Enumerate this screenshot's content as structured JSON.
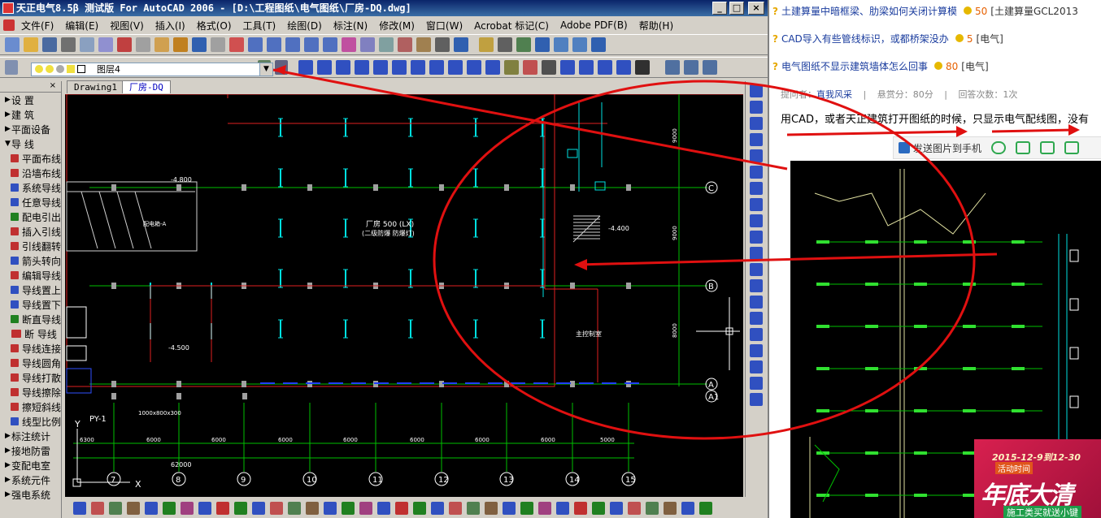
{
  "window": {
    "title": "天正电气8.5β 测试版 For AutoCAD 2006 - [D:\\工程图纸\\电气图纸\\厂房-DQ.dwg]",
    "min": "_",
    "max": "□",
    "close": "×"
  },
  "menu": [
    "文件(F)",
    "编辑(E)",
    "视图(V)",
    "插入(I)",
    "格式(O)",
    "工具(T)",
    "绘图(D)",
    "标注(N)",
    "修改(M)",
    "窗口(W)",
    "Acrobat 标记(C)",
    "Adobe PDF(B)",
    "帮助(H)"
  ],
  "layer": {
    "name": "图层4"
  },
  "panel": {
    "close": "×",
    "items": [
      {
        "arrow": "▶",
        "label": "设  置",
        "color": ""
      },
      {
        "arrow": "▶",
        "label": "建  筑",
        "color": ""
      },
      {
        "arrow": "▶",
        "label": "平面设备",
        "color": ""
      },
      {
        "arrow": "▼",
        "label": "导  线",
        "color": ""
      },
      {
        "arrow": "",
        "label": "平面布线",
        "color": "#c03030"
      },
      {
        "arrow": "",
        "label": "沿墙布线",
        "color": "#c03030"
      },
      {
        "arrow": "",
        "label": "系统导线",
        "color": "#3050c0"
      },
      {
        "arrow": "",
        "label": "任意导线",
        "color": "#3050c0"
      },
      {
        "arrow": "",
        "label": "配电引出",
        "color": "#208020"
      },
      {
        "arrow": "",
        "label": "插入引线",
        "color": "#c03030"
      },
      {
        "arrow": "",
        "label": "引线翻转",
        "color": "#c03030"
      },
      {
        "arrow": "",
        "label": "箭头转向",
        "color": "#3050c0"
      },
      {
        "arrow": "",
        "label": "编辑导线",
        "color": "#c03030"
      },
      {
        "arrow": "",
        "label": "导线置上",
        "color": "#3050c0"
      },
      {
        "arrow": "",
        "label": "导线置下",
        "color": "#3050c0"
      },
      {
        "arrow": "",
        "label": "断直导线",
        "color": "#208020"
      },
      {
        "arrow": "",
        "label": "断  导线",
        "color": "#c03030"
      },
      {
        "arrow": "",
        "label": "导线连接",
        "color": "#c03030"
      },
      {
        "arrow": "",
        "label": "导线圆角",
        "color": "#c03030"
      },
      {
        "arrow": "",
        "label": "导线打散",
        "color": "#c03030"
      },
      {
        "arrow": "",
        "label": "导线擦除",
        "color": "#c03030"
      },
      {
        "arrow": "",
        "label": "擦短斜线",
        "color": "#c03030"
      },
      {
        "arrow": "",
        "label": "线型比例",
        "color": "#3050c0"
      },
      {
        "arrow": "▶",
        "label": "标注统计",
        "color": ""
      },
      {
        "arrow": "▶",
        "label": "接地防雷",
        "color": ""
      },
      {
        "arrow": "▶",
        "label": "变配电室",
        "color": ""
      },
      {
        "arrow": "▶",
        "label": "系统元件",
        "color": ""
      },
      {
        "arrow": "▶",
        "label": "强电系统",
        "color": ""
      }
    ]
  },
  "tabs": [
    {
      "label": "Drawing1"
    },
    {
      "label": "厂房-DQ"
    }
  ],
  "drawing": {
    "room_label": "厂房 500 (LX)",
    "room_sub": "(二级防爆 防爆灯)",
    "room2": "主控制室",
    "axis_rows": [
      "C",
      "B",
      "A",
      "A1"
    ],
    "axis_cols": [
      "7",
      "8",
      "9",
      "10",
      "11",
      "12",
      "13",
      "14",
      "15"
    ],
    "dims": [
      "6300",
      "6000",
      "6000",
      "6000",
      "6000",
      "6000",
      "6000",
      "6000",
      "5000"
    ],
    "total_dim": "62000",
    "row_dims": [
      "9000",
      "9000",
      "8000"
    ],
    "elev1": "-4.800",
    "elev2": "-4.400",
    "elev3": "-4.500",
    "elev4": "-4.800",
    "box_label": "配电箱-A",
    "ps_label": "PY-1",
    "y_axis": "Y",
    "x_axis": "X",
    "misc": "1000x800x300"
  },
  "web": {
    "questions": [
      {
        "title": "土建算量中暗框梁、肋梁如何关闭计算模",
        "points": "50",
        "category": "[土建算量GCL2013"
      },
      {
        "title": "CAD导入有些管线标识，或都桥架没办",
        "points": "5",
        "category": "[电气]"
      },
      {
        "title": "电气图纸不显示建筑墙体怎么回事",
        "points": "80",
        "category": "[电气]"
      }
    ],
    "meta": {
      "asker_label": "提问者：",
      "asker": "直我风采",
      "reward": "悬赏分：80分",
      "answers": "回答次数：1次",
      "sep": "|"
    },
    "body": "用CAD，或者天正建筑打开图纸的时候，只显示电气配线图，没有",
    "send": "发送图片到手机"
  },
  "ad": {
    "date": "2015-12-9到12-30",
    "tag": "活动时间",
    "headline": "年底大清",
    "sub": "施工类买就送小键"
  }
}
